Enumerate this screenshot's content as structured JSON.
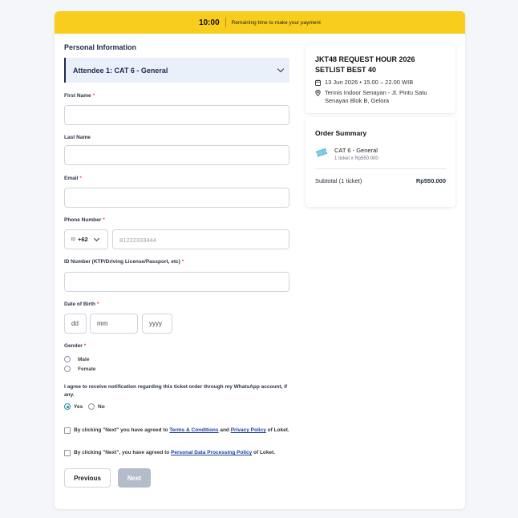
{
  "timer": {
    "time": "10:00",
    "message": "Remaining time to make your payment"
  },
  "form": {
    "section_title": "Personal Information",
    "attendee_label": "Attendee 1: CAT 6 - General",
    "first_name_label": "First Name",
    "last_name_label": "Last Name",
    "email_label": "Email",
    "phone_label": "Phone Number",
    "country_flag": "ID",
    "country_code": "+62",
    "phone_placeholder": "81222333444",
    "id_number_label": "ID Number (KTP/Driving License/Passport, etc)",
    "dob_label": "Date of Birth",
    "dob_day_placeholder": "dd",
    "dob_month_placeholder": "mm",
    "dob_year_placeholder": "yyyy",
    "gender_label": "Gender",
    "gender_male": "Male",
    "gender_female": "Female",
    "whatsapp_text": "I agree to receive notification regarding this ticket order through my WhatsApp account, if any.",
    "whatsapp_yes": "Yes",
    "whatsapp_no": "No",
    "agree1_prefix": "By clicking \"Next\" you have agreed to",
    "agree1_terms": "Terms & Conditions",
    "agree1_and": "and",
    "agree1_privacy": "Privacy Policy",
    "agree1_suffix": "of Loket.",
    "agree2_prefix": "By clicking \"Next\", you have agreed to",
    "agree2_link": "Personal Data Processing Policy",
    "agree2_suffix": "of Loket.",
    "previous_label": "Previous",
    "next_label": "Next"
  },
  "event": {
    "title": "JKT48 REQUEST HOUR 2026 SETLIST BEST 40",
    "date": "13 Jun 2026 • 15.00 – 22.00 WIB",
    "venue": "Tennis Indoor Senayan - Jl. Pintu Satu Senayan Blok B, Gelora"
  },
  "order_summary": {
    "title": "Order Summary",
    "item_name": "CAT 6 - General",
    "item_qty": "1 ticket x Rp550.000",
    "subtotal_label": "Subtotal (1 ticket)",
    "subtotal_value": "Rp550.000"
  },
  "colors": {
    "timer_bg": "#f9cd1b",
    "accent": "#1c2a4d",
    "link": "#1a3fa0",
    "radio_selected": "#1787a3",
    "required": "#e5484d"
  }
}
